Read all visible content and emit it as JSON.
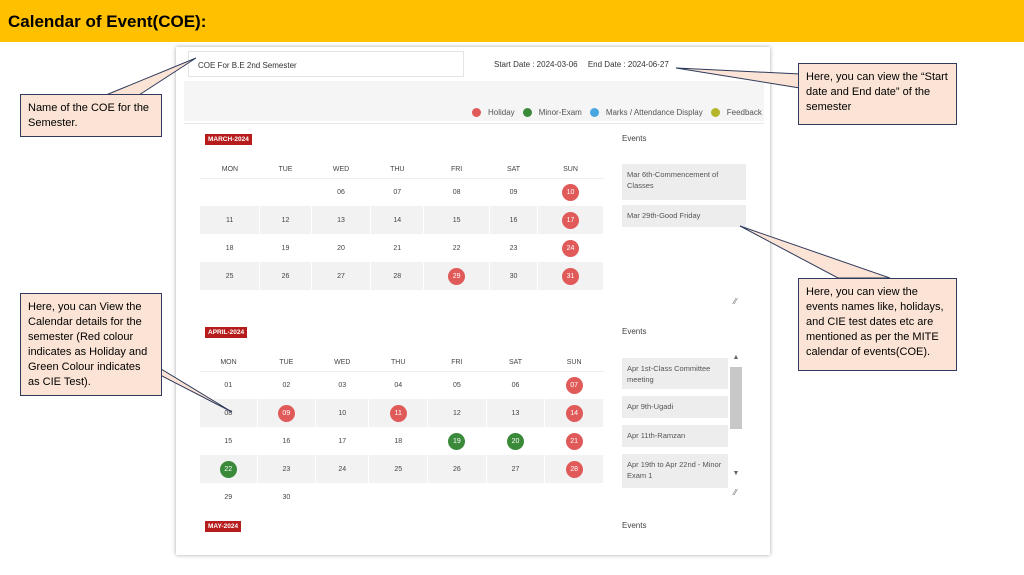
{
  "title": "Calendar of Event(COE):",
  "coe_name": "COE For B.E 2nd Semester",
  "start_date": "Start Date : 2024-03-06",
  "end_date": "End Date : 2024-06-27",
  "legend": [
    {
      "label": "Holiday",
      "color": "#e05a5a"
    },
    {
      "label": "Minor-Exam",
      "color": "#3a8a3a"
    },
    {
      "label": "Marks / Attendance Display",
      "color": "#4aa6e0"
    },
    {
      "label": "Feedback",
      "color": "#b5b52a"
    }
  ],
  "days": [
    "MON",
    "TUE",
    "WED",
    "THU",
    "FRI",
    "SAT",
    "SUN"
  ],
  "march": {
    "label": "MARCH-2024",
    "events_heading": "Events",
    "events": [
      "Mar 6th-Commencement of Classes",
      "Mar 29th-Good Friday"
    ],
    "weeks": [
      [
        [
          "",
          ""
        ],
        [
          "",
          ""
        ],
        [
          "06",
          ""
        ],
        [
          "07",
          ""
        ],
        [
          "08",
          ""
        ],
        [
          "09",
          ""
        ],
        [
          "10",
          "red"
        ]
      ],
      [
        [
          "11",
          ""
        ],
        [
          "12",
          ""
        ],
        [
          "13",
          ""
        ],
        [
          "14",
          ""
        ],
        [
          "15",
          ""
        ],
        [
          "16",
          ""
        ],
        [
          "17",
          "red"
        ]
      ],
      [
        [
          "18",
          ""
        ],
        [
          "19",
          ""
        ],
        [
          "20",
          ""
        ],
        [
          "21",
          ""
        ],
        [
          "22",
          ""
        ],
        [
          "23",
          ""
        ],
        [
          "24",
          "red"
        ]
      ],
      [
        [
          "25",
          ""
        ],
        [
          "26",
          ""
        ],
        [
          "27",
          ""
        ],
        [
          "28",
          ""
        ],
        [
          "29",
          "red"
        ],
        [
          "30",
          ""
        ],
        [
          "31",
          "red"
        ]
      ]
    ]
  },
  "april": {
    "label": "APRIL-2024",
    "events_heading": "Events",
    "events": [
      "Apr 1st-Class Committee meeting",
      "Apr 9th-Ugadi",
      "Apr 11th-Ramzan",
      "Apr 19th to Apr 22nd - Minor Exam 1"
    ],
    "weeks": [
      [
        [
          "01",
          ""
        ],
        [
          "02",
          ""
        ],
        [
          "03",
          ""
        ],
        [
          "04",
          ""
        ],
        [
          "05",
          ""
        ],
        [
          "06",
          ""
        ],
        [
          "07",
          "red"
        ]
      ],
      [
        [
          "08",
          ""
        ],
        [
          "09",
          "red"
        ],
        [
          "10",
          ""
        ],
        [
          "11",
          "red"
        ],
        [
          "12",
          ""
        ],
        [
          "13",
          ""
        ],
        [
          "14",
          "red"
        ]
      ],
      [
        [
          "15",
          ""
        ],
        [
          "16",
          ""
        ],
        [
          "17",
          ""
        ],
        [
          "18",
          ""
        ],
        [
          "19",
          "green"
        ],
        [
          "20",
          "green"
        ],
        [
          "21",
          "red"
        ]
      ],
      [
        [
          "22",
          "green"
        ],
        [
          "23",
          ""
        ],
        [
          "24",
          ""
        ],
        [
          "25",
          ""
        ],
        [
          "26",
          ""
        ],
        [
          "27",
          ""
        ],
        [
          "28",
          "red"
        ]
      ],
      [
        [
          "29",
          ""
        ],
        [
          "30",
          ""
        ],
        [
          "",
          ""
        ],
        [
          "",
          ""
        ],
        [
          "",
          ""
        ],
        [
          "",
          ""
        ],
        [
          "",
          ""
        ]
      ]
    ]
  },
  "may": {
    "label": "MAY-2024",
    "events_heading": "Events"
  },
  "callouts": {
    "coe_name": "Name of the COE for the Semester.",
    "dates": "Here, you can view the “Start date and End date” of the semester",
    "calendar": "Here, you can View the Calendar details for the semester (Red colour indicates as Holiday and Green Colour indicates as CIE Test).",
    "events": "Here, you can view the events names like, holidays, and CIE test dates etc are mentioned as per the MITE calendar of events(COE)."
  }
}
